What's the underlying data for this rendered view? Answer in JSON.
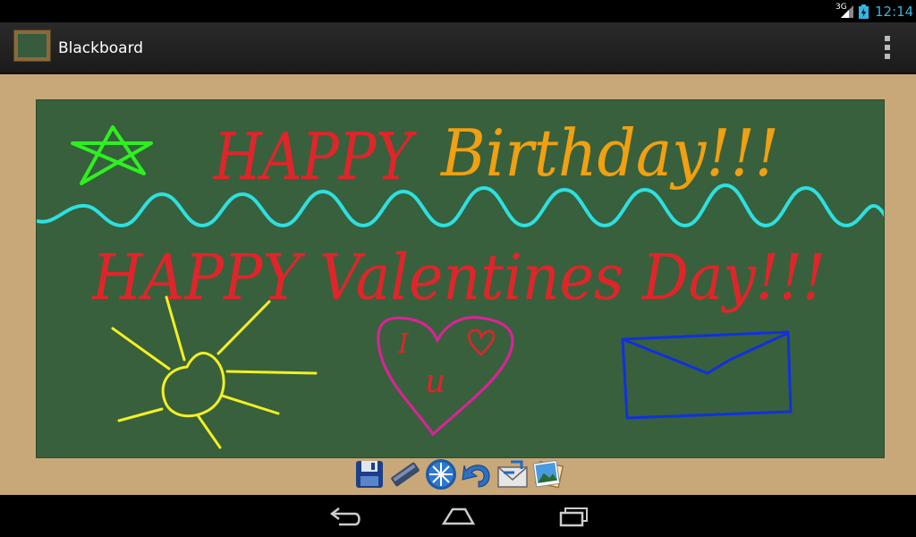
{
  "status": {
    "network": "3G",
    "time": "12:14"
  },
  "app": {
    "title": "Blackboard"
  },
  "board": {
    "line1_part1": "HAPPY",
    "line1_part2": "Birthday!!!",
    "line2": "HAPPY Valentines Day!!!",
    "heart_text_top": "I",
    "heart_text_bottom": "u"
  },
  "colors": {
    "board": "#38603d",
    "frame": "#c8a878",
    "red": "#e0252a",
    "orange": "#f0a010",
    "cyan": "#2de0e0",
    "green": "#2ef020",
    "yellow": "#f4f020",
    "magenta": "#e0209a",
    "blue": "#1030e0"
  },
  "toolbar": {
    "items": [
      "save-icon",
      "chalk-icon",
      "clear-icon",
      "undo-icon",
      "share-icon",
      "background-image-icon"
    ]
  },
  "navbar": {
    "items": [
      "back-icon",
      "home-icon",
      "recents-icon"
    ]
  }
}
